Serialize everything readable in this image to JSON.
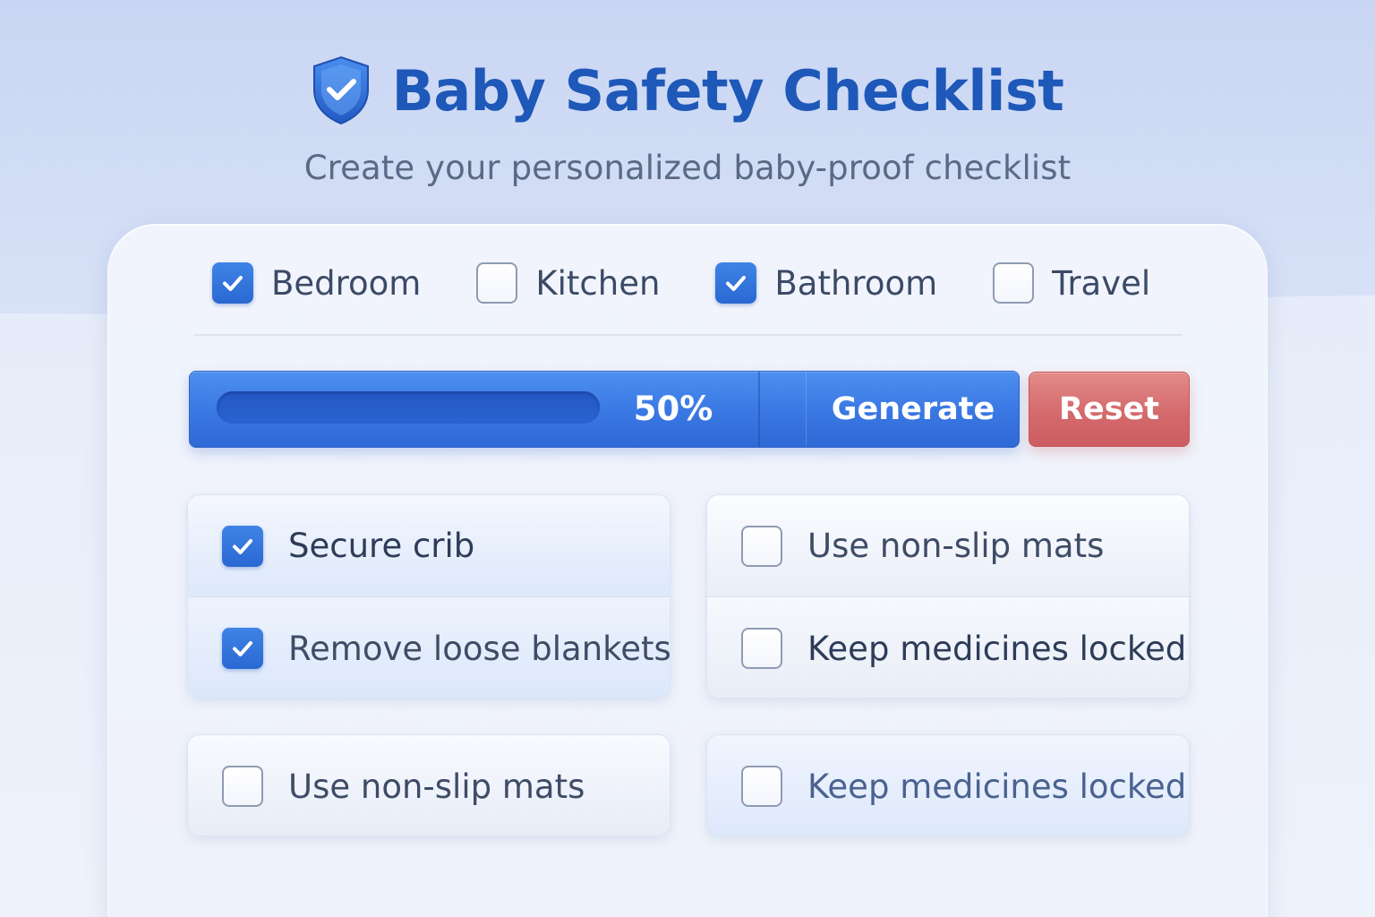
{
  "header": {
    "icon": "shield-check-icon",
    "title": "Baby Safety Checklist",
    "subtitle": "Create your personalized baby-proof checklist"
  },
  "colors": {
    "accent": "#2f6ad6",
    "title": "#1e58b8",
    "reset": "#d46a6c"
  },
  "categories": [
    {
      "label": "Bedroom",
      "checked": true
    },
    {
      "label": "Kitchen",
      "checked": false
    },
    {
      "label": "Bathroom",
      "checked": true
    },
    {
      "label": "Travel",
      "checked": false
    }
  ],
  "actions": {
    "progress_percent": 50,
    "progress_label": "50%",
    "generate_label": "Generate",
    "reset_label": "Reset"
  },
  "checklist": [
    {
      "label": "Secure crib",
      "checked": true
    },
    {
      "label": "Remove loose blankets",
      "checked": true
    },
    {
      "label": "Use non-slip mats",
      "checked": false
    },
    {
      "label": "Keep medicines locked",
      "checked": false
    },
    {
      "label": "Use non-slip mats",
      "checked": false
    },
    {
      "label": "Keep medicines locked",
      "checked": false
    }
  ]
}
